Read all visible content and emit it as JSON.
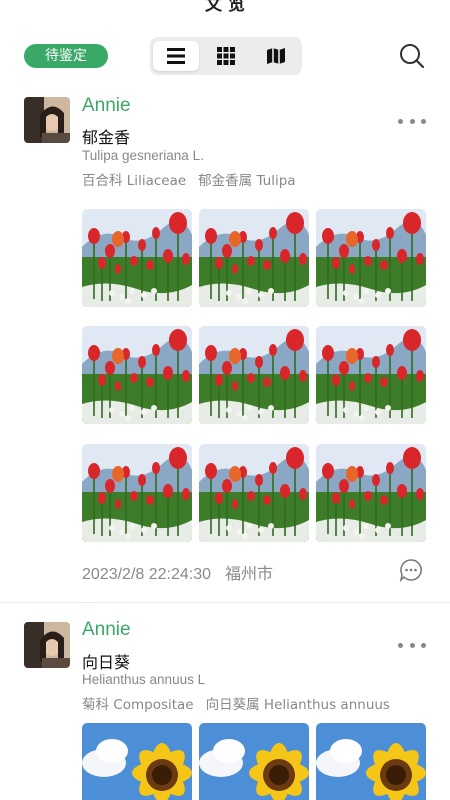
{
  "header": {
    "title": "文 览"
  },
  "toolbar": {
    "filter_badge": "待鉴定",
    "views": [
      {
        "icon": "list-icon",
        "active": true
      },
      {
        "icon": "grid-icon",
        "active": false
      },
      {
        "icon": "map-icon",
        "active": false
      }
    ],
    "search_icon": "search-icon"
  },
  "posts": [
    {
      "user": "Annie",
      "plant_name": "郁金香",
      "latin_name": "Tulipa gesneriana L.",
      "family": "百合科 Liliaceae",
      "genus": "郁金香属 Tulipa",
      "photo_subject": "tulip",
      "photo_count": 9,
      "date": "2023/2/8  22:24:30",
      "city": "福州市"
    },
    {
      "user": "Annie",
      "plant_name": "向日葵",
      "latin_name": "Helianthus annuus L",
      "family": "菊科 Compositae",
      "genus": "向日葵属 Helianthus annuus",
      "photo_subject": "sunflower",
      "photo_count": 3
    }
  ],
  "colors": {
    "accent": "#3aa866",
    "muted": "#888888"
  }
}
